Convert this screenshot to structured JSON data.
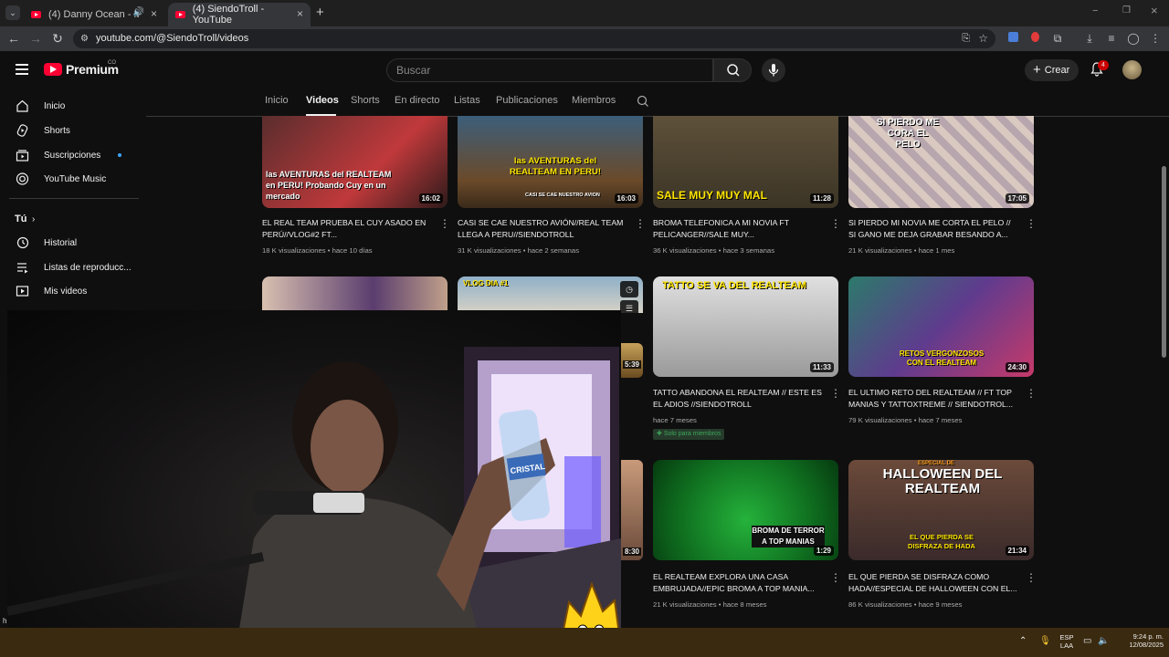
{
  "browser": {
    "tabs": [
      {
        "title": "(4) Danny Ocean - Me Reh",
        "audio_icon": "speaker-icon",
        "close": "×"
      },
      {
        "title": "(4) SiendoTroll - YouTube",
        "close": "×"
      }
    ],
    "new_tab": "+",
    "url": "youtube.com/@SiendoTroll/videos",
    "window_controls": [
      "−",
      "❐",
      "×"
    ]
  },
  "youtube": {
    "logo_text": "Premium",
    "region": "CO",
    "search_placeholder": "Buscar",
    "create_label": "Crear",
    "notifications_count": "4"
  },
  "sidebar": {
    "items": [
      {
        "label": "Inicio",
        "icon": "home-icon"
      },
      {
        "label": "Shorts",
        "icon": "shorts-icon"
      },
      {
        "label": "Suscripciones",
        "icon": "subscriptions-icon",
        "dot": true
      },
      {
        "label": "YouTube Music",
        "icon": "youtube-music-icon"
      }
    ],
    "you_section": "Tú",
    "you_items": [
      {
        "label": "Historial",
        "icon": "history-icon"
      },
      {
        "label": "Listas de reproducc...",
        "icon": "playlists-icon"
      },
      {
        "label": "Mis videos",
        "icon": "my-videos-icon"
      }
    ]
  },
  "channel_tabs": [
    "Inicio",
    "Videos",
    "Shorts",
    "En directo",
    "Listas",
    "Publicaciones",
    "Miembros"
  ],
  "videos_row1": [
    {
      "title": "EL REAL TEAM PRUEBA EL CUY ASADO EN PERÚ//VLOG#2 FT...",
      "views": "18 K visualizaciones",
      "age": "hace 10 días",
      "duration": "16:02",
      "overlay": "las AVENTURAS del REALTEAM en PERU! Probando Cuy en un mercado",
      "colors": [
        "#5a2d2d",
        "#c0393b"
      ]
    },
    {
      "title": "CASI SE CAE NUESTRO AVIÓN//REAL TEAM LLEGA A PERU//SIENDOTROLL",
      "views": "31 K visualizaciones",
      "age": "hace 2 semanas",
      "duration": "16:03",
      "overlay": "las AVENTURAS del REALTEAM EN PERU!",
      "sub_overlay": "CASI SE CAE NUESTRO AVION",
      "colors": [
        "#6b4a2a",
        "#3c5e7a"
      ]
    },
    {
      "title": "BROMA TELEFONICA A MI NOVIA FT PELICANGER//SALE MUY...",
      "views": "36 K visualizaciones",
      "age": "hace 3 semanas",
      "duration": "11:28",
      "overlay": "SALE MUY MUY MAL",
      "colors": [
        "#3b3425",
        "#5e513a"
      ]
    },
    {
      "title": "SI PIERDO MI NOVIA ME CORTA EL PELO // SI GANO ME DEJA GRABAR BESANDO A...",
      "views": "21 K visualizaciones",
      "age": "hace 1 mes",
      "duration": "17:05",
      "overlay": "SI PIERDO ME CORA EL PELO",
      "colors": [
        "#d9c9c0",
        "#b7a6ad"
      ]
    }
  ],
  "videos_row2": [
    {
      "title": "TATTO ABANDONA EL REALTEAM // ESTE ES EL ADIOS //SIENDOTROLL",
      "age": "hace 7 meses",
      "badge": "Solo para miembros",
      "duration": "11:33",
      "overlay": "TATTO SE VA DEL REALTEAM",
      "colors": [
        "#cfcfcf",
        "#9a9a9a"
      ]
    },
    {
      "title": "EL ULTIMO RETO DEL REALTEAM // FT TOP MANIAS Y TATTOXTREME // SIENDOTROL...",
      "views": "79 K visualizaciones",
      "age": "hace 7 meses",
      "duration": "24:30",
      "overlay": "RETOS VERGONZOSOS CON EL REALTEAM",
      "colors": [
        "#5f3b8e",
        "#2c7a6b"
      ]
    }
  ],
  "videos_row3": [
    {
      "title": "EL REALTEAM EXPLORA UNA CASA EMBRUJADA//EPIC BROMA A TOP MANIA...",
      "views": "21 K visualizaciones",
      "age": "hace 8 meses",
      "duration": "1:29",
      "overlay": "BROMA DE TERROR A TOP MANIAS",
      "colors": [
        "#0f6e1f",
        "#25b23b"
      ]
    },
    {
      "title": "EL QUE PIERDA SE DISFRAZA COMO HADA//ESPECIAL DE HALLOWEEN CON EL...",
      "views": "86 K visualizaciones",
      "age": "hace 9 meses",
      "duration": "21:34",
      "overlay": "HALLOWEEN DEL REALTEAM",
      "top_overlay": "ESPECIAL DE",
      "sub_overlay": "EL QUE PIERDA SE DISFRAZA DE HADA",
      "colors": [
        "#3a2a2a",
        "#6b4a3a"
      ]
    }
  ],
  "partial_durations": [
    "5:39",
    "8:30"
  ],
  "partial_titles": [
    "VLOG DIA #1"
  ],
  "webcam": {
    "bottle_label": "CRISTAL"
  },
  "taskbar": {
    "lang": "ESP",
    "lang2": "LAA",
    "time": "9:24 p. m.",
    "date": "12/08/2025",
    "tray_label": "h"
  }
}
